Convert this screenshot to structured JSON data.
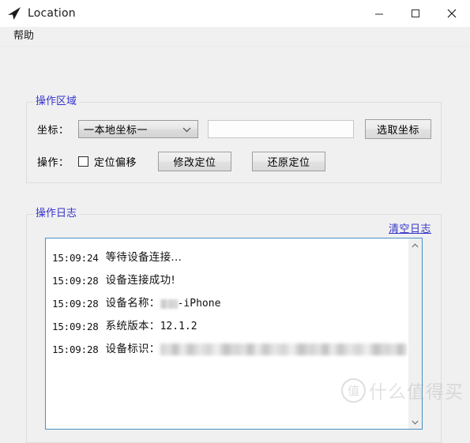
{
  "window": {
    "title": "Location",
    "icon": "navigation-arrow-icon",
    "controls": {
      "minimize": "–",
      "maximize": "□",
      "close": "✕"
    }
  },
  "menubar": {
    "items": [
      {
        "label": "帮助"
      }
    ]
  },
  "operation_group": {
    "title": "操作区域",
    "coord_label": "坐标：",
    "coord_select": {
      "value": "一本地坐标一",
      "options": [
        "一本地坐标一"
      ]
    },
    "coord_input": {
      "value": "",
      "placeholder": ""
    },
    "pick_coord_button": "选取坐标",
    "action_label": "操作：",
    "offset_checkbox": {
      "label": "定位偏移",
      "checked": false
    },
    "modify_button": "修改定位",
    "restore_button": "还原定位"
  },
  "log_group": {
    "title": "操作日志",
    "clear_link": "清空日志",
    "entries": [
      {
        "time": "15:09:24",
        "message": "等待设备连接...",
        "redacted": "none"
      },
      {
        "time": "15:09:28",
        "message": "设备连接成功!",
        "redacted": "none"
      },
      {
        "time": "15:09:28",
        "message": "设备名称：",
        "suffix": "-iPhone",
        "redacted": "small"
      },
      {
        "time": "15:09:28",
        "message": "系统版本：",
        "suffix": "12.1.2",
        "redacted": "none"
      },
      {
        "time": "15:09:28",
        "message": "设备标识：",
        "suffix": "",
        "redacted": "long"
      }
    ]
  },
  "watermark": {
    "badge": "值",
    "text": "什么值得买"
  },
  "colors": {
    "group_title": "#3333cc",
    "link": "#3333cc",
    "log_border": "#4a90c4",
    "window_bg": "#f0f0f0"
  }
}
